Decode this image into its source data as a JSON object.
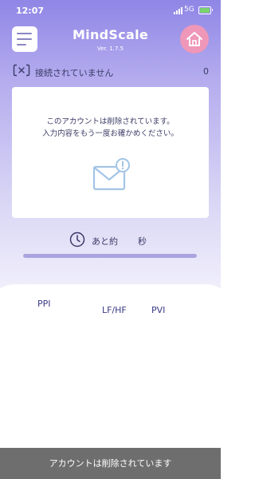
{
  "status_bar": {
    "time": "12:07",
    "network": "5G"
  },
  "header": {
    "title": "MindScale",
    "version": "Ver. 1.7.5"
  },
  "connection": {
    "status_text": "接続されていません",
    "count": "0"
  },
  "message_card": {
    "line1": "このアカウントは削除されています。",
    "line2": "入力内容をもう一度お確かめください。"
  },
  "timer": {
    "remaining_label": "あと約",
    "seconds_unit": "秒"
  },
  "progress": {
    "fraction": 1.0
  },
  "metrics": {
    "ppi": "PPI",
    "lfhf": "LF/HF",
    "pvi": "PVI"
  },
  "toast": {
    "text": "アカウントは削除されています"
  },
  "colors": {
    "accent": "#8f86e6",
    "home_button": "#ef97b8",
    "toast_bg": "#6e6e6e"
  }
}
